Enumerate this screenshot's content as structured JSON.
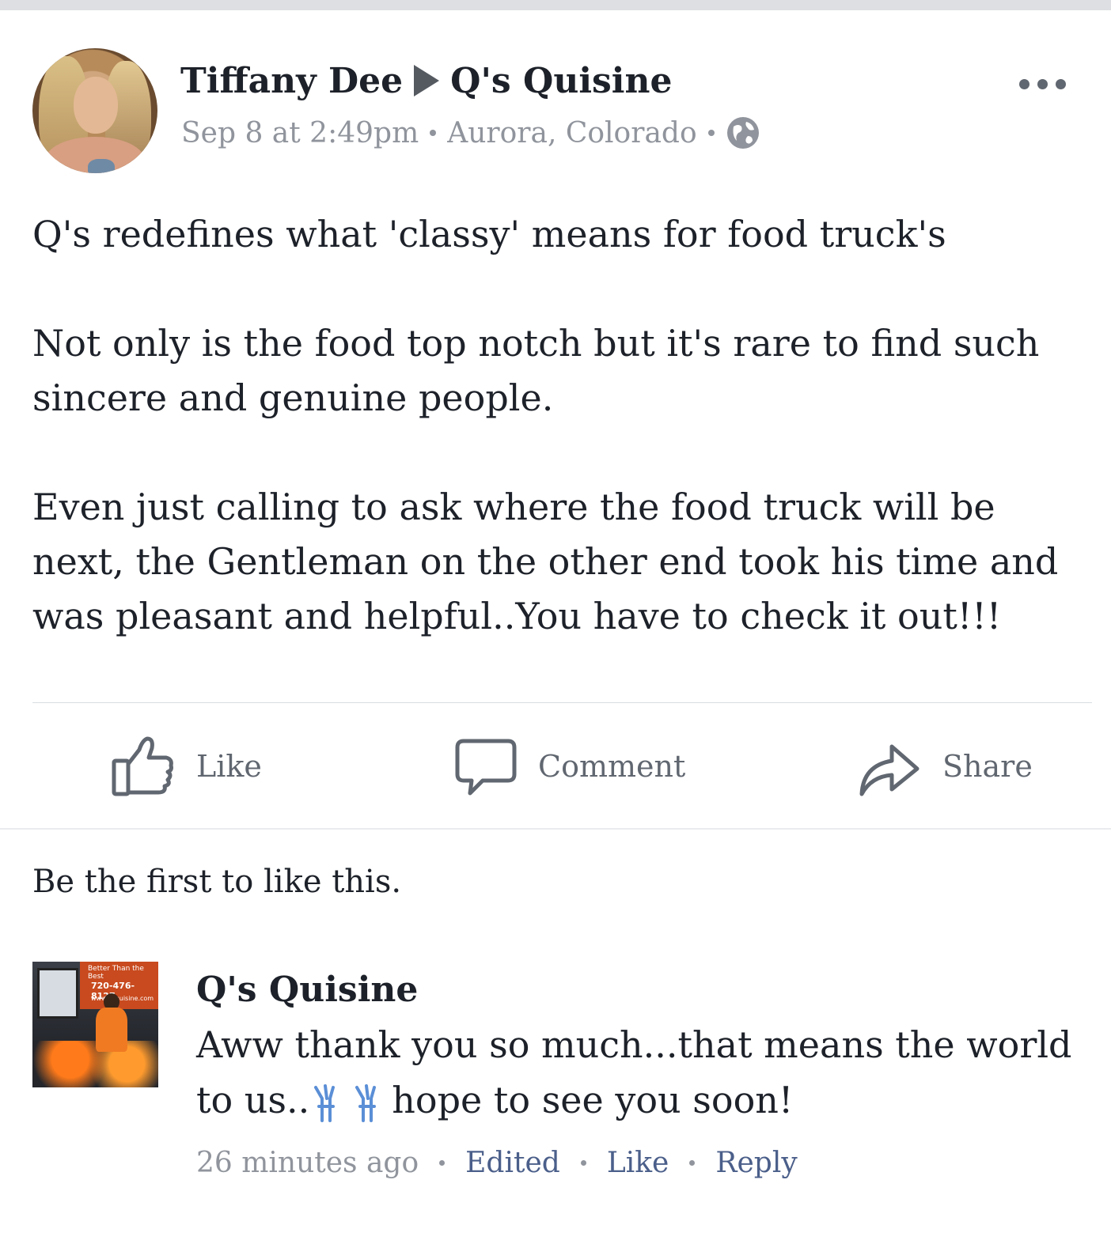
{
  "post": {
    "author": "Tiffany Dee",
    "target_page": "Q's Quisine",
    "timestamp": "Sep 8 at 2:49pm",
    "location": "Aurora, Colorado",
    "privacy_icon": "globe-icon",
    "more_icon": "more-options-icon",
    "paragraphs": [
      "Q's redefines what 'classy' means for food truck's",
      "Not only is the food top notch but it's rare to find such sincere and genuine people.",
      "Even just calling to ask where the food truck will be next, the  Gentleman on the other end took his time and was pleasant and helpful..You have to check it out!!!"
    ]
  },
  "actions": {
    "like_label": "Like",
    "comment_label": "Comment",
    "share_label": "Share"
  },
  "likes_summary": "Be the first to like this.",
  "comment": {
    "author": "Q's Quisine",
    "text_before_emoji": "Aww thank you so much...that means the world to us..",
    "emoji_icon": "raising-hands-emoji",
    "text_after_emoji": "hope to see you soon!",
    "avatar_text": {
      "tagline": "Better Than the Best",
      "phone": "720-476-8127",
      "website": "www.qsquisine.com"
    },
    "time": "26 minutes ago",
    "edited_label": "Edited",
    "like_label": "Like",
    "reply_label": "Reply"
  },
  "colors": {
    "primary_text": "#1d2129",
    "secondary_text": "#90949c",
    "icon_gray": "#616770",
    "link_blue": "#4b5f8a"
  }
}
